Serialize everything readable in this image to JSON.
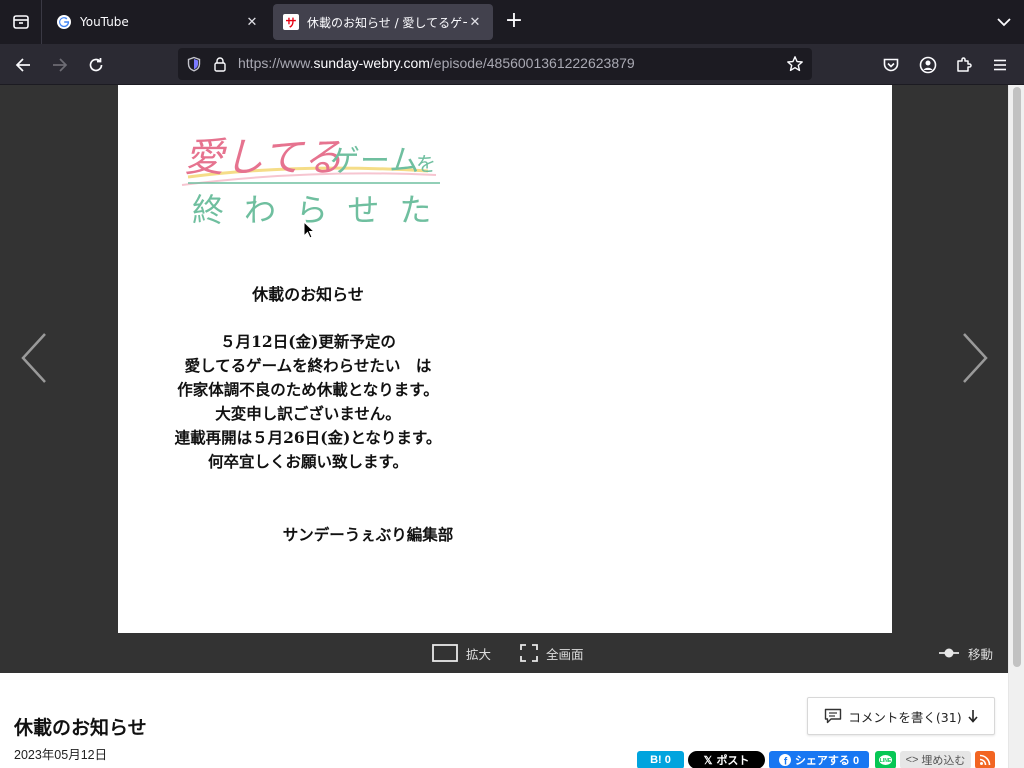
{
  "browser": {
    "tabs": [
      {
        "title": "YouTube",
        "icon": "google-icon",
        "active": false
      },
      {
        "title": "休載のお知らせ / 愛してるゲーム",
        "icon": "sunday-webry-icon",
        "active": true
      }
    ],
    "url": {
      "prefix": "https://www.",
      "domain": "sunday-webry.com",
      "path": "/episode/4856001361222623879"
    }
  },
  "comic": {
    "logo": {
      "line1": "愛してるゲームを",
      "line2": "終わらせたい"
    },
    "notice_title": "休載のお知らせ",
    "lines": [
      "５月12日(金)更新予定の",
      "愛してるゲームを終わらせたい　は",
      "作家体調不良のため休載となります。",
      "大変申し訳ございません。",
      "連載再開は５月26日(金)となります。",
      "何卒宜しくお願い致します。"
    ],
    "signature": "サンデーうぇぶり編集部"
  },
  "viewer_toolbar": {
    "zoom_label": "拡大",
    "fullscreen_label": "全画面",
    "move_label": "移動"
  },
  "episode": {
    "title": "休載のお知らせ",
    "date": "2023年05月12日",
    "comment_button": "コメントを書く(31)"
  },
  "share": {
    "hatena": "B! 0",
    "x": "ポスト",
    "facebook": "シェアする 0",
    "embed": "埋め込む"
  },
  "colors": {
    "viewer_bg": "#333333",
    "logo_pink": "#e6738f",
    "logo_green": "#6fbf9f",
    "hatena": "#00a4de",
    "facebook": "#1877f2",
    "line": "#06c755",
    "rss": "#f26522"
  }
}
